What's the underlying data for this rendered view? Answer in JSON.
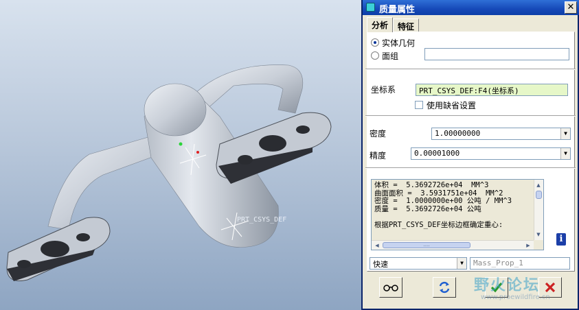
{
  "viewport": {
    "csys_label": "PRT_CSYS_DEF"
  },
  "dialog": {
    "title": "质量属性",
    "close_glyph": "✕",
    "tabs": [
      "分析",
      "特征"
    ],
    "geometry_options": [
      {
        "label": "实体几何",
        "selected": true
      },
      {
        "label": "面组",
        "selected": false
      }
    ],
    "quilt_field": "",
    "csys_label": "坐标系",
    "csys_value": "PRT_CSYS_DEF:F4(坐标系)",
    "use_default_label": "使用缺省设置",
    "use_default_checked": false,
    "density_label": "密度",
    "density_value": "1.00000000",
    "accuracy_label": "精度",
    "accuracy_value": "0.00001000",
    "results_text": "体积 =  5.3692726e+04  MM^3\n曲面面积 =  3.5931751e+04  MM^2\n密度 =  1.0000000e+00 公吨 / MM^3\n质量 =  5.3692726e+04 公吨\n\n根据PRT_CSYS_DEF坐标边框确定重心:",
    "scroll_thumb_glyph": "....",
    "info_glyph": "i",
    "mode_value": "快速",
    "feature_name_placeholder": "Mass_Prop_1",
    "buttons": {
      "preview_icon": "glasses-icon",
      "repeat_icon": "repeat-icon",
      "ok_icon": "checkmark-icon",
      "cancel_icon": "cancel-x-icon"
    }
  },
  "watermark": {
    "text": "野火论坛",
    "url": "www.proewildfire.cn"
  },
  "colors": {
    "title_bar": "#1649b8",
    "csys_field": "#e6f7c8",
    "ok_green": "#2a9a2a",
    "cancel_red": "#cc2222"
  }
}
